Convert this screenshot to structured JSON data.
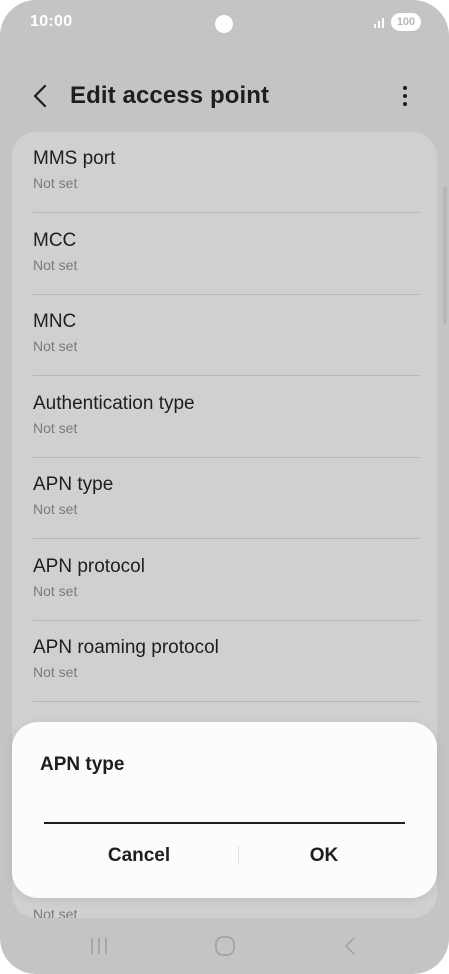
{
  "status_bar": {
    "time": "10:00",
    "battery": "100"
  },
  "header": {
    "title": "Edit access point"
  },
  "list": {
    "items": [
      {
        "title": "MMS port",
        "value": "Not set"
      },
      {
        "title": "MCC",
        "value": "Not set"
      },
      {
        "title": "MNC",
        "value": "Not set"
      },
      {
        "title": "Authentication type",
        "value": "Not set"
      },
      {
        "title": "APN type",
        "value": "Not set"
      },
      {
        "title": "APN protocol",
        "value": "Not set"
      },
      {
        "title": "APN roaming protocol",
        "value": "Not set"
      }
    ],
    "partial_bottom_value": "Not set"
  },
  "dialog": {
    "title": "APN type",
    "input_value": "",
    "cancel_label": "Cancel",
    "ok_label": "OK"
  },
  "icons": {
    "back": "back-chevron-icon",
    "more": "more-vertical-icon",
    "nav_recent": "recent-apps-icon",
    "nav_home": "home-icon",
    "nav_back": "nav-back-icon"
  },
  "colors": {
    "dim_background": "#c4c4c6",
    "card": "#d0d0d2",
    "dialog": "#fcfcfe",
    "text": "#1e1e1e",
    "subtext": "#7a7a7c"
  }
}
